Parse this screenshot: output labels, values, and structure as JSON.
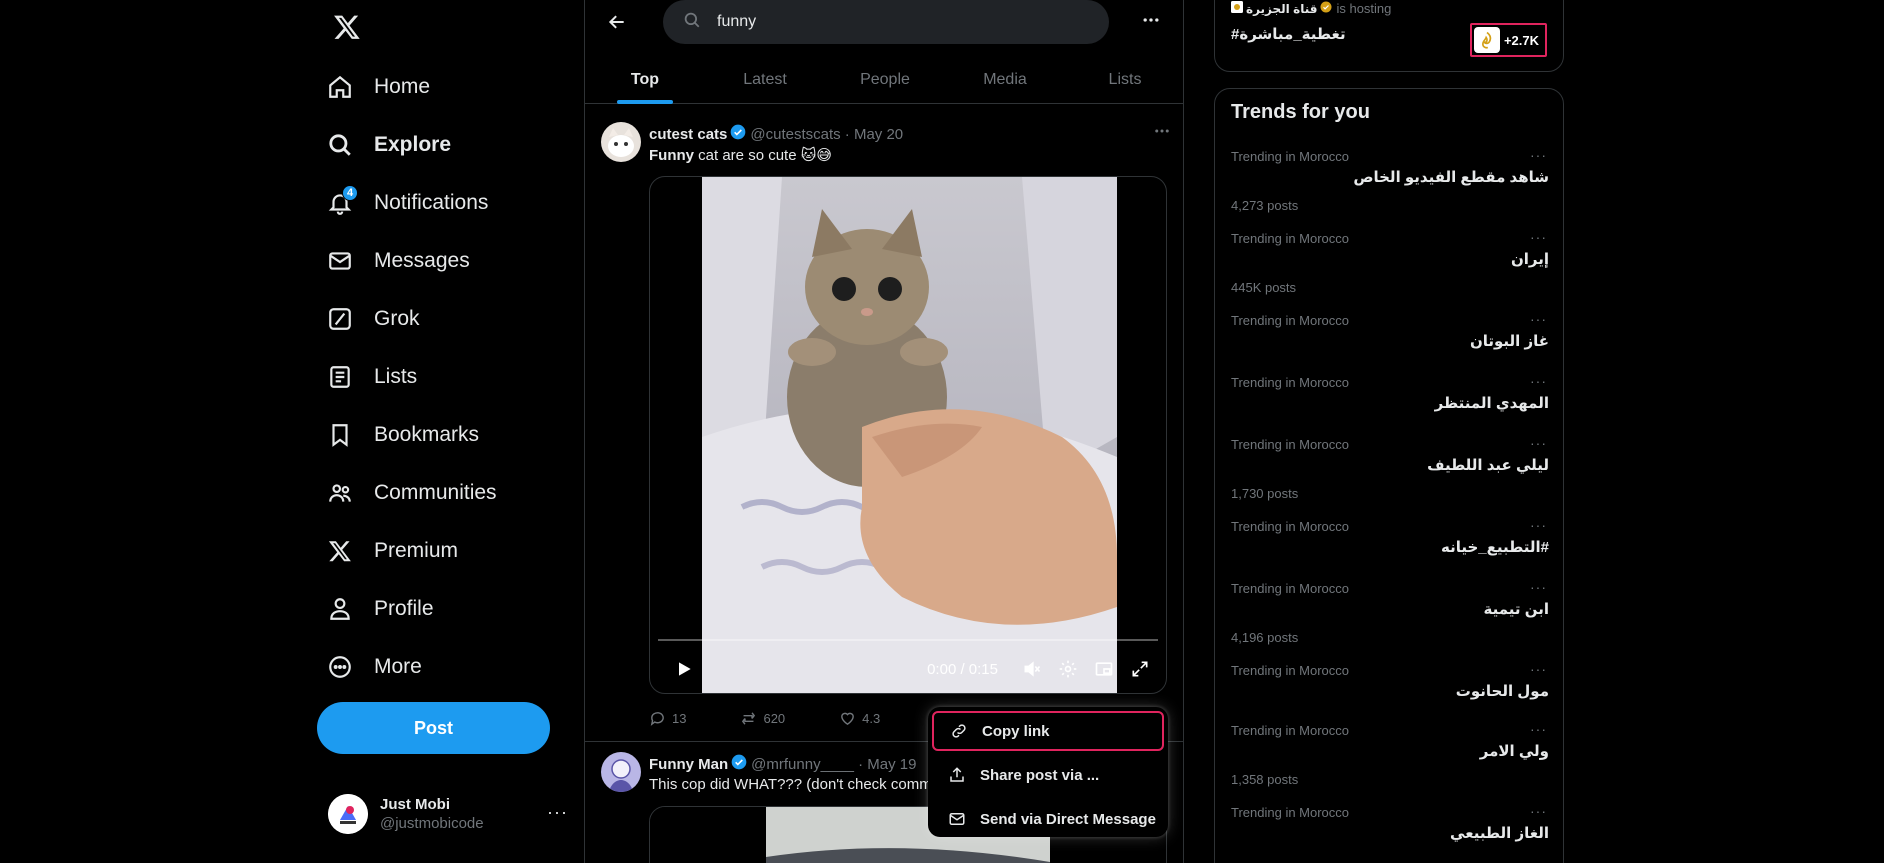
{
  "sidebar": {
    "nav": [
      {
        "label": "Home",
        "icon": "home-icon"
      },
      {
        "label": "Explore",
        "icon": "search-icon"
      },
      {
        "label": "Notifications",
        "icon": "bell-icon"
      },
      {
        "label": "Messages",
        "icon": "envelope-icon"
      },
      {
        "label": "Grok",
        "icon": "grok-icon"
      },
      {
        "label": "Lists",
        "icon": "list-icon"
      },
      {
        "label": "Bookmarks",
        "icon": "bookmark-icon"
      },
      {
        "label": "Communities",
        "icon": "people-icon"
      },
      {
        "label": "Premium",
        "icon": "x-logo-icon"
      },
      {
        "label": "Profile",
        "icon": "person-icon"
      },
      {
        "label": "More",
        "icon": "more-circle-icon"
      }
    ],
    "notifications_badge": "4",
    "post_label": "Post",
    "account": {
      "name": "Just Mobi",
      "handle": "@justmobicode",
      "more": "···"
    }
  },
  "search": {
    "value": "funny"
  },
  "tabs": [
    "Top",
    "Latest",
    "People",
    "Media",
    "Lists"
  ],
  "tweets": [
    {
      "name": "cutest cats",
      "meta": "@cutestscats · May 20",
      "text_bold": "Funny",
      "text_rest": " cat are so cute 🐱😅",
      "video_time": "0:00 / 0:15",
      "replies": "13",
      "reposts": "620",
      "likes": "4.3"
    },
    {
      "name": "Funny Man",
      "meta": "@mrfunny____ · May 19",
      "text": "This cop did WHAT??? (don't check comm"
    }
  ],
  "menu": {
    "items": [
      {
        "label": "Copy link",
        "icon": "link-icon"
      },
      {
        "label": "Share post via ...",
        "icon": "share-icon"
      },
      {
        "label": "Send via Direct Message",
        "icon": "envelope-icon"
      }
    ]
  },
  "live": {
    "host_name": "قناة الجزيرة",
    "host_suffix": "is hosting",
    "title": "#تغطية_مباشرة",
    "listeners": "+2.7K"
  },
  "trends": {
    "title": "Trends for you",
    "items": [
      {
        "context": "Trending in Morocco",
        "name": "شاهد مقطع الفيديو الخاص",
        "count": "4,273 posts"
      },
      {
        "context": "Trending in Morocco",
        "name": "إيران",
        "count": "445K posts"
      },
      {
        "context": "Trending in Morocco",
        "name": "غاز البوتان",
        "count": ""
      },
      {
        "context": "Trending in Morocco",
        "name": "المهدي المنتظر",
        "count": ""
      },
      {
        "context": "Trending in Morocco",
        "name": "ليلي عبد اللطيف",
        "count": "1,730 posts"
      },
      {
        "context": "Trending in Morocco",
        "name": "#التطبيع_خيانه",
        "count": ""
      },
      {
        "context": "Trending in Morocco",
        "name": "ابن تيمية",
        "count": "4,196 posts"
      },
      {
        "context": "Trending in Morocco",
        "name": "مول الحانوت",
        "count": ""
      },
      {
        "context": "Trending in Morocco",
        "name": "ولي الامر",
        "count": "1,358 posts"
      },
      {
        "context": "Trending in Morocco",
        "name": "الغاز الطبيعي",
        "count": ""
      }
    ]
  },
  "colors": {
    "accent": "#1d9bf0",
    "highlight": "#e0245e",
    "background": "#000000",
    "border": "#2f3336",
    "muted": "#71767b"
  }
}
